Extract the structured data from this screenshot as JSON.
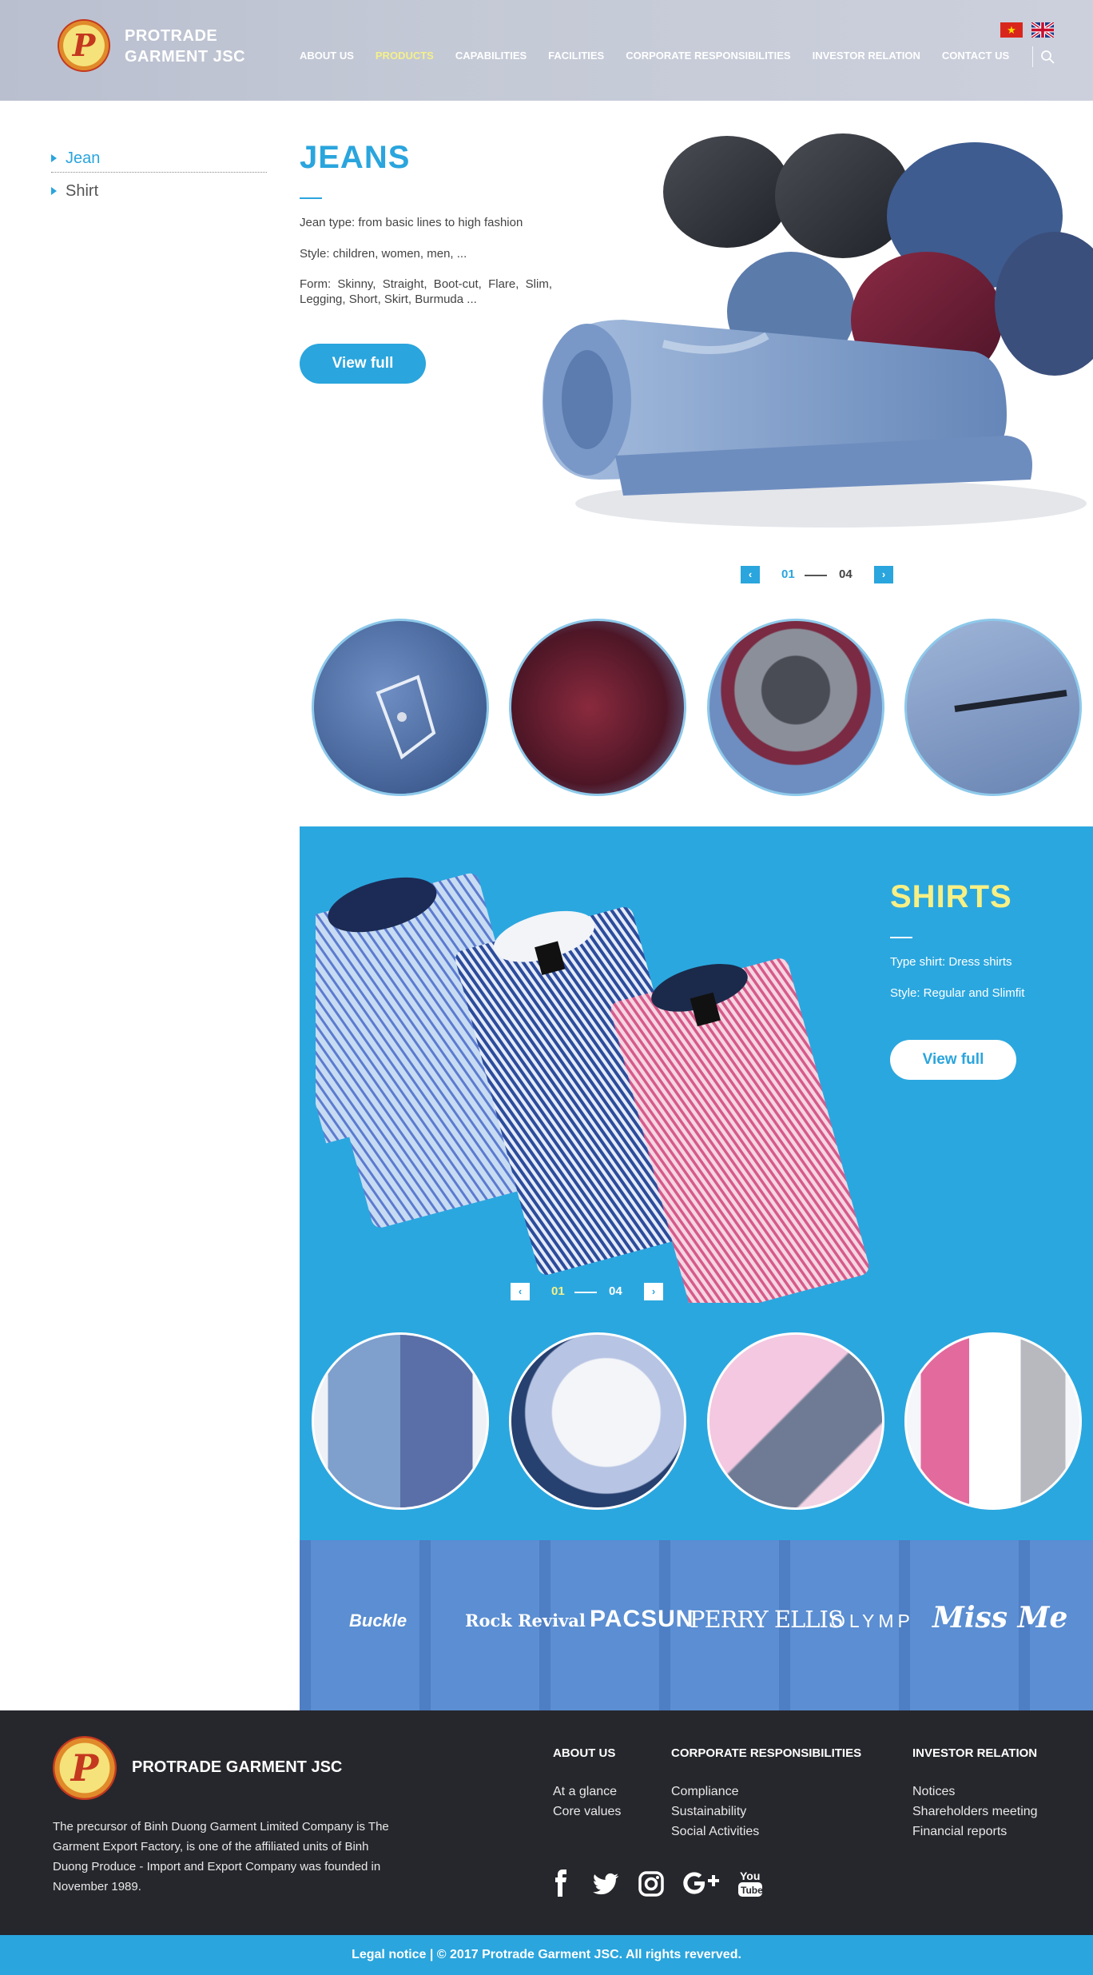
{
  "header": {
    "logo_letter": "P",
    "brand_line1": "PROTRADE",
    "brand_line2": "GARMENT JSC",
    "nav": [
      "ABOUT US",
      "PRODUCTS",
      "CAPABILITIES",
      "FACILITIES",
      "CORPORATE RESPONSIBILITIES",
      "INVESTOR RELATION",
      "CONTACT US"
    ],
    "active_nav": "PRODUCTS",
    "flags": [
      "vietnam-flag-icon",
      "uk-flag-icon"
    ],
    "search_icon": "search-icon"
  },
  "sidebar": {
    "items": [
      {
        "label": "Jean",
        "active": true
      },
      {
        "label": "Shirt",
        "active": false
      }
    ]
  },
  "jeans": {
    "title": "JEANS",
    "line1": "Jean type: from basic lines to high fashion",
    "line2": "Style: children, women, men, ...",
    "line3": "Form: Skinny, Straight, Boot-cut, Flare, Slim, Legging, Short, Skirt, Burmuda ...",
    "button": "View full",
    "pager": {
      "prev": "‹",
      "current": "01",
      "total": "04",
      "next": "›"
    },
    "thumbnails": [
      "jeans-embroidered-pocket",
      "jeans-red-denim-jacket",
      "jeans-rolled-stack",
      "jeans-zipper-closeup"
    ]
  },
  "shirts": {
    "title": "SHIRTS",
    "line1": "Type shirt: Dress shirts",
    "line2": "Style: Regular and Slimfit",
    "button": "View full",
    "pager": {
      "prev": "‹",
      "current": "01",
      "total": "04",
      "next": "›"
    },
    "thumbnails": [
      "shirts-plaid-pair",
      "shirt-white-collar",
      "shirt-grey-cuff",
      "shirts-pink-white-grey"
    ]
  },
  "brands": [
    "Buckle",
    "Rock Revival",
    "PACSUN",
    "PERRY ELLIS",
    "OLYMP",
    "Miss Me"
  ],
  "footer": {
    "brand": "PROTRADE GARMENT JSC",
    "description": "The precursor of Binh Duong Garment Limited Company is The Garment Export Factory, is one of the affiliated units of Binh Duong Produce - Import and Export Company was founded in November 1989.",
    "columns": [
      {
        "heading": "ABOUT US",
        "links": [
          "At a glance",
          "Core values"
        ]
      },
      {
        "heading": "CORPORATE RESPONSIBILITIES",
        "links": [
          "Compliance",
          "Sustainability",
          "Social Activities"
        ]
      },
      {
        "heading": "INVESTOR RELATION",
        "links": [
          "Notices",
          "Shareholders meeting",
          "Financial reports"
        ]
      }
    ],
    "social": [
      "facebook-icon",
      "twitter-icon",
      "instagram-icon",
      "google-plus-icon",
      "youtube-icon"
    ],
    "copyright": "Legal notice | © 2017 Protrade Garment JSC. All rights reverved."
  },
  "colors": {
    "accent": "#2aa5dd",
    "highlight": "#f7f085",
    "footer_bg": "#26272c"
  }
}
